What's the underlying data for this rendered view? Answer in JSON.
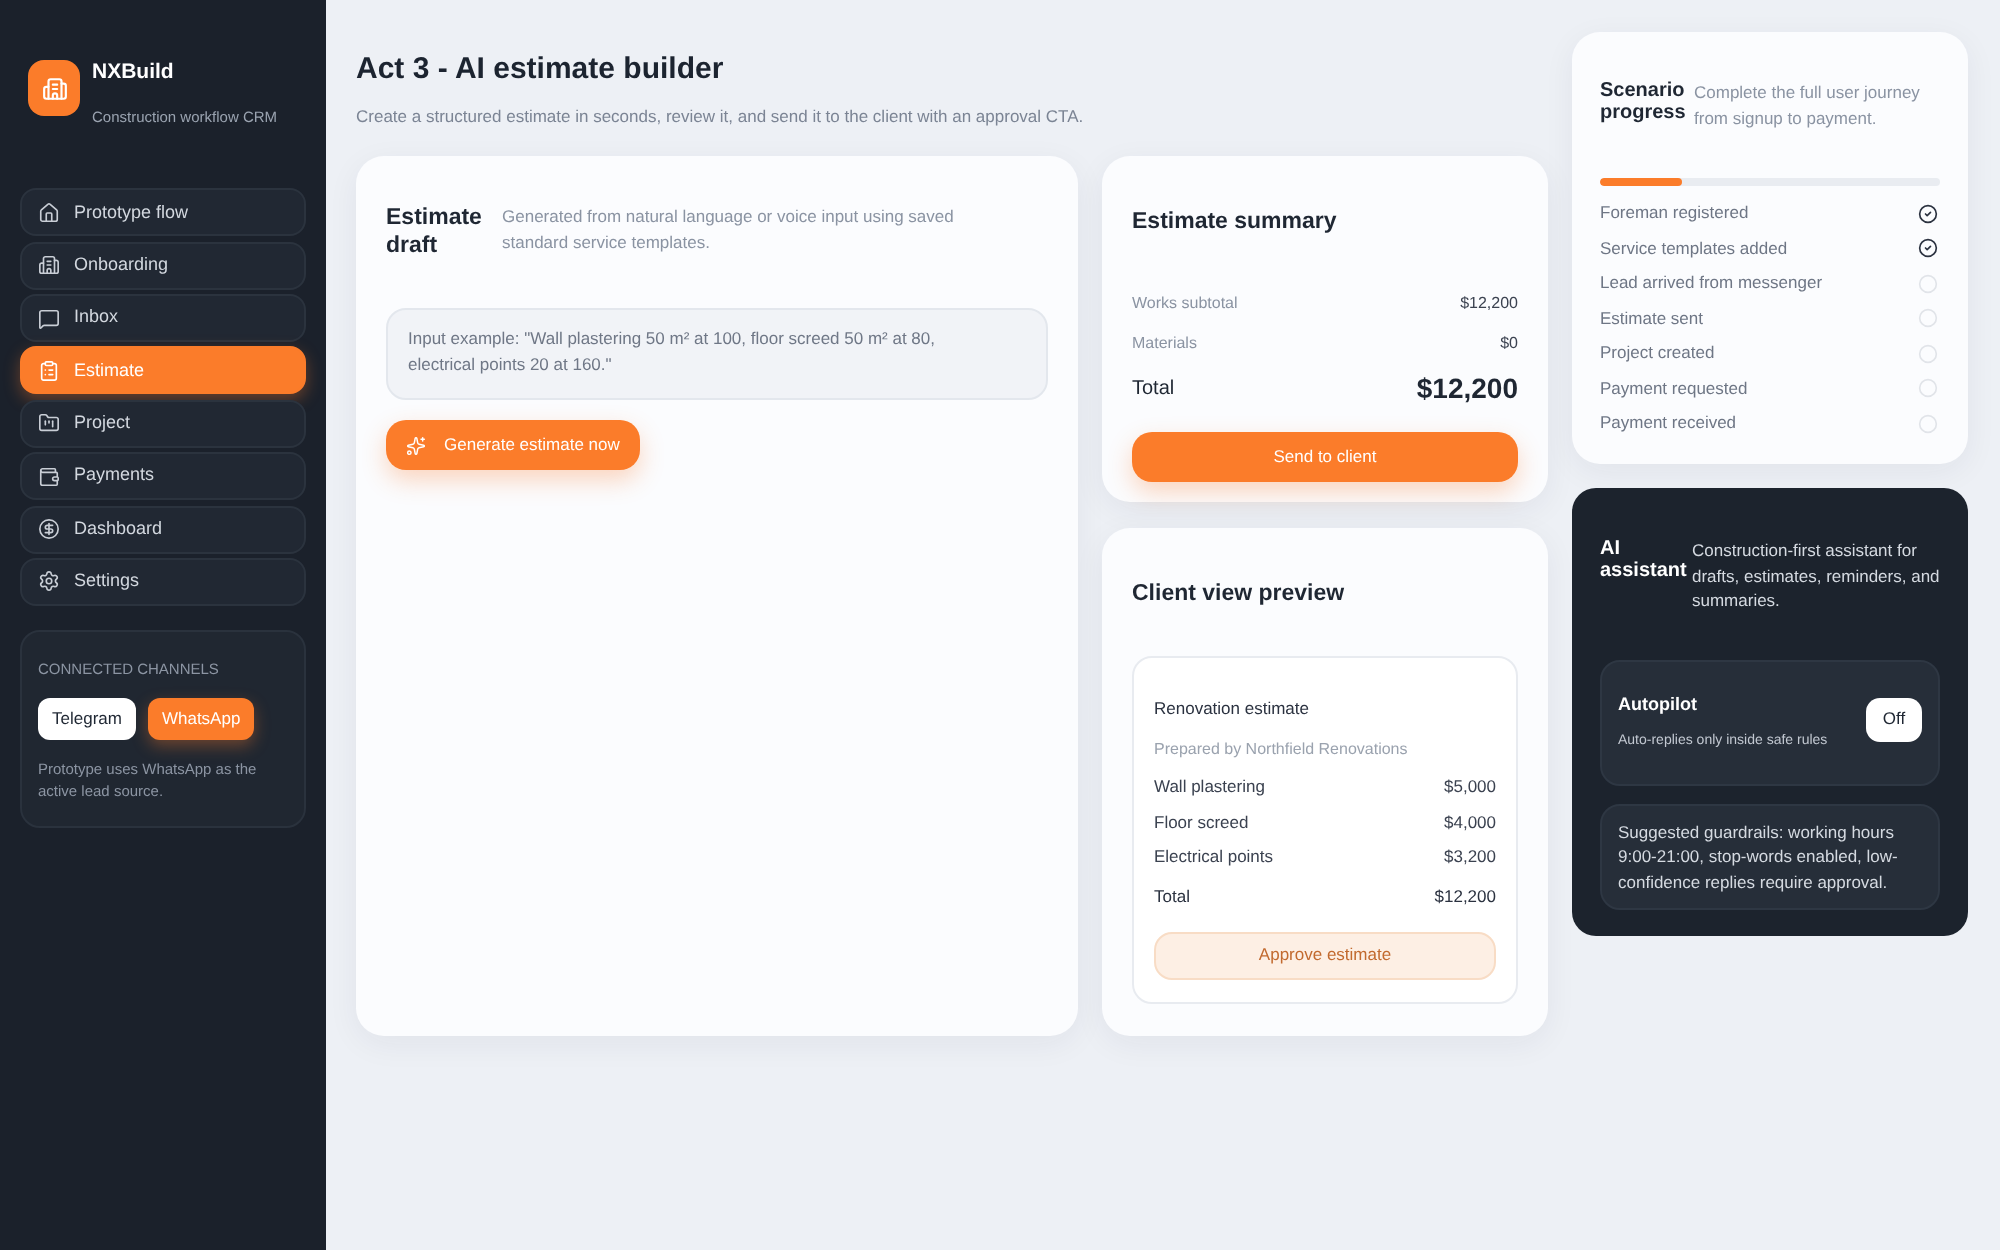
{
  "sidebar": {
    "brand": {
      "name": "NXBuild",
      "tagline": "Construction workflow CRM"
    },
    "nav": [
      {
        "label": "Prototype flow",
        "selected": false
      },
      {
        "label": "Onboarding",
        "selected": false
      },
      {
        "label": "Inbox",
        "selected": false
      },
      {
        "label": "Estimate",
        "selected": true
      },
      {
        "label": "Project",
        "selected": false
      },
      {
        "label": "Payments",
        "selected": false
      },
      {
        "label": "Dashboard",
        "selected": false
      },
      {
        "label": "Settings",
        "selected": false
      }
    ],
    "channels": {
      "heading": "CONNECTED CHANNELS",
      "items": [
        {
          "label": "Telegram",
          "selected": false
        },
        {
          "label": "WhatsApp",
          "selected": true
        }
      ],
      "note": "Prototype uses WhatsApp as the active lead source."
    }
  },
  "header": {
    "title": "Act 3 - AI estimate builder",
    "subtitle": "Create a structured estimate in seconds, review it, and send it to the client with an approval CTA."
  },
  "estimate_draft": {
    "title": "Estimate draft",
    "description": "Generated from natural language or voice input using saved standard service templates.",
    "input": {
      "placeholder": "Input example: \"Wall plastering 50 m² at 100, floor screed 50 m² at 80, electrical points 20 at 160.\""
    },
    "button": "Generate estimate now"
  },
  "estimate_summary": {
    "title": "Estimate summary",
    "rows": [
      {
        "label": "Works subtotal",
        "value": "$12,200"
      },
      {
        "label": "Materials",
        "value": "$0"
      }
    ],
    "total": {
      "label": "Total",
      "value": "$12,200"
    },
    "button": "Send to client"
  },
  "client_preview": {
    "title": "Client view preview",
    "document": {
      "title": "Renovation estimate",
      "prepared_by": "Prepared by Northfield Renovations",
      "lines": [
        {
          "label": "Wall plastering",
          "value": "$5,000"
        },
        {
          "label": "Floor screed",
          "value": "$4,000"
        },
        {
          "label": "Electrical points",
          "value": "$3,200"
        }
      ],
      "total": {
        "label": "Total",
        "value": "$12,200"
      },
      "button": "Approve estimate"
    }
  },
  "scenario_progress": {
    "title": "Scenario progress",
    "description": "Complete the full user journey from signup to payment.",
    "level": 0.24,
    "steps": [
      {
        "label": "Foreman registered",
        "done": true
      },
      {
        "label": "Service templates added",
        "done": true
      },
      {
        "label": "Lead arrived from messenger",
        "done": false
      },
      {
        "label": "Estimate sent",
        "done": false
      },
      {
        "label": "Project created",
        "done": false
      },
      {
        "label": "Payment requested",
        "done": false
      },
      {
        "label": "Payment received",
        "done": false
      }
    ]
  },
  "ai_assistant": {
    "title": "AI assistant",
    "description": "Construction-first assistant for drafts, estimates, reminders, and summaries.",
    "autopilot": {
      "title": "Autopilot",
      "note": "Auto-replies only inside safe rules",
      "on": false,
      "toggle_label": "Off"
    },
    "guardrails": "Suggested guardrails: working hours 9:00-21:00, stop-words enabled, low-confidence replies require approval."
  }
}
